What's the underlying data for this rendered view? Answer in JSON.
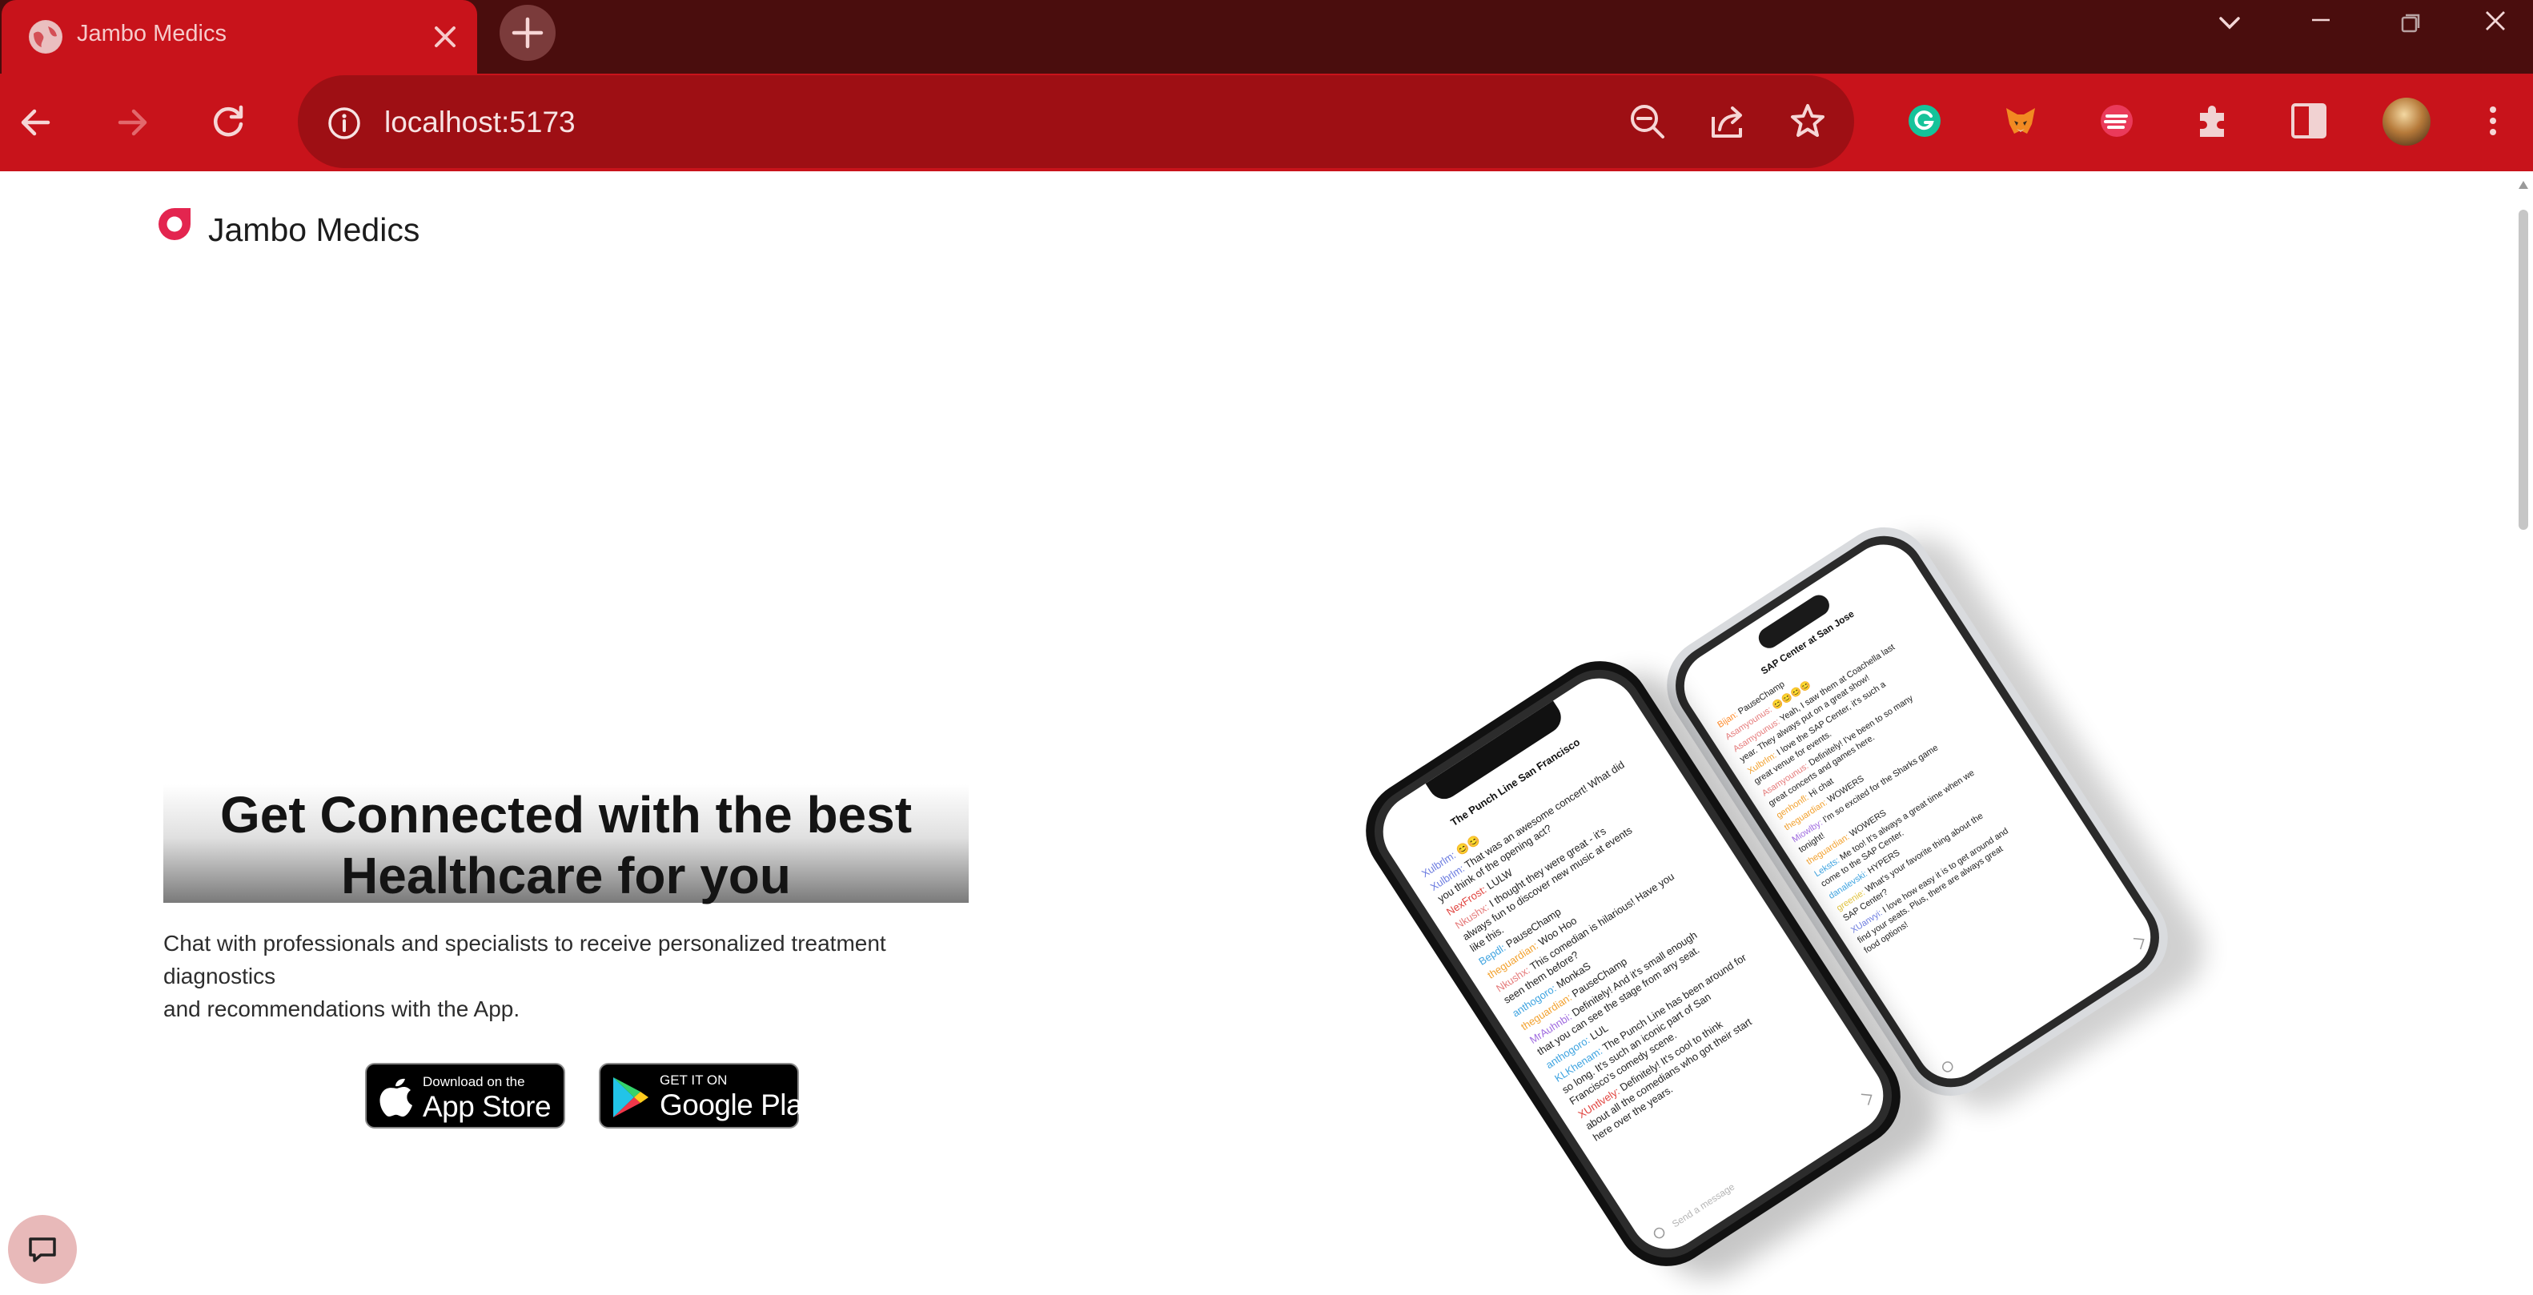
{
  "browser": {
    "tab": {
      "title": "Jambo Medics",
      "favicon": "globe-icon",
      "close_icon": "close-icon"
    },
    "new_tab_icon": "plus-icon",
    "window_controls": [
      "tab-search-icon",
      "minimize-icon",
      "restore-icon",
      "close-icon"
    ],
    "nav": [
      "back-icon",
      "forward-icon",
      "reload-icon"
    ],
    "address": {
      "url": "localhost:5173",
      "site_info_icon": "info-icon"
    },
    "omnibox_actions": [
      "zoom-out-icon",
      "share-icon",
      "bookmark-star-icon"
    ],
    "extensions": [
      "grammarly-icon",
      "metamask-icon",
      "extension-icon",
      "extensions-puzzle-icon",
      "side-panel-icon"
    ],
    "profile": "profile-avatar",
    "menu_icon": "kebab-menu-icon",
    "accent_color": "#c8131b",
    "frame_color": "#4a0d0d"
  },
  "page": {
    "brand": {
      "name": "Jambo Medics",
      "logo": "jambo-logo-icon",
      "logo_color": "#e3254f"
    },
    "hero": {
      "title_line1": "Get Connected with the best",
      "title_line2": "Healthcare for you",
      "subtitle_line1": "Chat with professionals and specialists to receive personalized treatment diagnostics",
      "subtitle_line2": "and recommendations with the App."
    },
    "store_buttons": {
      "app_store": {
        "small": "Download on the",
        "big": "App Store",
        "icon": "apple-icon"
      },
      "google_play": {
        "small": "GET IT ON",
        "big": "Google Play",
        "icon": "google-play-icon"
      }
    },
    "phone_back": {
      "header": "SAP Center at San Jose",
      "messages": [
        {
          "user": "Bijan",
          "text": "PauseChamp",
          "color": "#ff8c2b"
        },
        {
          "user": "Asamyounus",
          "text": "😊😊😊😊",
          "color": "#e57a7a"
        },
        {
          "user": "Asamyounus",
          "text": "Yeah, I saw them at Coachella last year. They always put on a great show!",
          "color": "#e57a7a"
        },
        {
          "user": "Xulbrlm",
          "text": "I love the SAP Center, it's such a great venue for events.",
          "color": "#f2a12e"
        },
        {
          "user": "Asamyounus",
          "text": "Definitely! I've been to so many great concerts and games here.",
          "color": "#e57a7a"
        },
        {
          "user": "genhonfl",
          "text": "Hi chat",
          "color": "#f2a12e"
        },
        {
          "user": "theguardian",
          "text": "WOWERS",
          "color": "#f2a12e"
        },
        {
          "user": "Miowlby",
          "text": "I'm so excited for the Sharks game tonight!",
          "color": "#a06ce0"
        },
        {
          "user": "theguardian",
          "text": "WOWERS",
          "color": "#f2a12e"
        },
        {
          "user": "Leksts",
          "text": "Me too! It's always a great time when we come to the SAP Center.",
          "color": "#3da3e0"
        },
        {
          "user": "danalevski",
          "text": "HYPERS",
          "color": "#3da3e0"
        },
        {
          "user": "greenie",
          "text": "What's your favorite thing about the SAP Center?",
          "color": "#e0c23d"
        },
        {
          "user": "XUanvyi",
          "text": "I love how easy it is to get around and find your seats. Plus, there are always great food options!",
          "color": "#6c7ce0"
        }
      ]
    },
    "phone_front": {
      "header": "The Punch Line San Francisco",
      "messages": [
        {
          "user": "Xulbrlm",
          "text": "😊😊",
          "color": "#6c7ce0"
        },
        {
          "user": "Xulbrlm",
          "text": "That was an awesome concert! What did you think of the opening act?",
          "color": "#6c7ce0"
        },
        {
          "user": "NexFrost",
          "text": "LULW",
          "color": "#e0423d"
        },
        {
          "user": "Nkushx",
          "text": "I thought they were great - it's always fun to discover new music at events like this.",
          "color": "#e57a7a"
        },
        {
          "user": "Bepdl",
          "text": "PauseChamp",
          "color": "#3da3e0"
        },
        {
          "user": "theguardian",
          "text": "Woo Hoo",
          "color": "#f2a12e"
        },
        {
          "user": "Nkushx",
          "text": "This comedian is hilarious! Have you seen them before?",
          "color": "#e57a7a"
        },
        {
          "user": "anthogoro",
          "text": "MonkaS",
          "color": "#3da3e0"
        },
        {
          "user": "theguardian",
          "text": "PauseChamp",
          "color": "#f2a12e"
        },
        {
          "user": "MrAuhnbi",
          "text": "Definitely! And it's small enough that you can see the stage from any seat.",
          "color": "#a06ce0"
        },
        {
          "user": "anthogoro",
          "text": "LUL",
          "color": "#3da3e0"
        },
        {
          "user": "KLKhenam",
          "text": "The Punch Line has been around for so long. It's such an iconic part of San Francisco's comedy scene.",
          "color": "#3da3e0"
        },
        {
          "user": "XUntlvely",
          "text": "Definitely! It's cool to think about all the comedians who got their start here over the years.",
          "color": "#e0423d"
        }
      ],
      "input_placeholder": "Send a message"
    },
    "chat_fab_icon": "chat-bubble-icon"
  }
}
